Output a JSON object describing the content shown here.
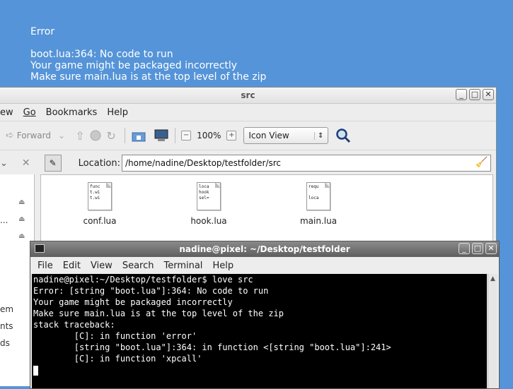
{
  "love_error": {
    "heading": "Error",
    "lines": [
      "boot.lua:364: No code to run",
      "Your game might be packaged incorrectly",
      "Make sure main.lua is at the top level of the zip"
    ]
  },
  "file_manager": {
    "title": "src",
    "menu": [
      "ew",
      "Go",
      "Bookmarks",
      "Help"
    ],
    "toolbar": {
      "forward_label": "Forward",
      "zoom_value": "100%",
      "view_mode": "Icon View"
    },
    "location_label": "Location:",
    "location_path": "/home/nadine/Desktop/testfolder/src",
    "sidebar_fragments": [
      "...",
      "em",
      "nts",
      "ds"
    ],
    "files": [
      {
        "name": "conf.lua",
        "preview": "func\nt.wi\nt.wi"
      },
      {
        "name": "hook.lua",
        "preview": "loca\nhook\nsel="
      },
      {
        "name": "main.lua",
        "preview": "requ\n\nloca"
      }
    ]
  },
  "terminal": {
    "title": "nadine@pixel: ~/Desktop/testfolder",
    "menu": [
      "File",
      "Edit",
      "View",
      "Search",
      "Terminal",
      "Help"
    ],
    "lines": [
      "nadine@pixel:~/Desktop/testfolder$ love src",
      "Error: [string \"boot.lua\"]:364: No code to run",
      "Your game might be packaged incorrectly",
      "Make sure main.lua is at the top level of the zip",
      "stack traceback:",
      "        [C]: in function 'error'",
      "        [string \"boot.lua\"]:364: in function <[string \"boot.lua\"]:241>",
      "        [C]: in function 'xpcall'"
    ]
  },
  "colors": {
    "desktop": "#5594d8",
    "terminal_bg": "#000000",
    "terminal_fg": "#ffffff"
  }
}
